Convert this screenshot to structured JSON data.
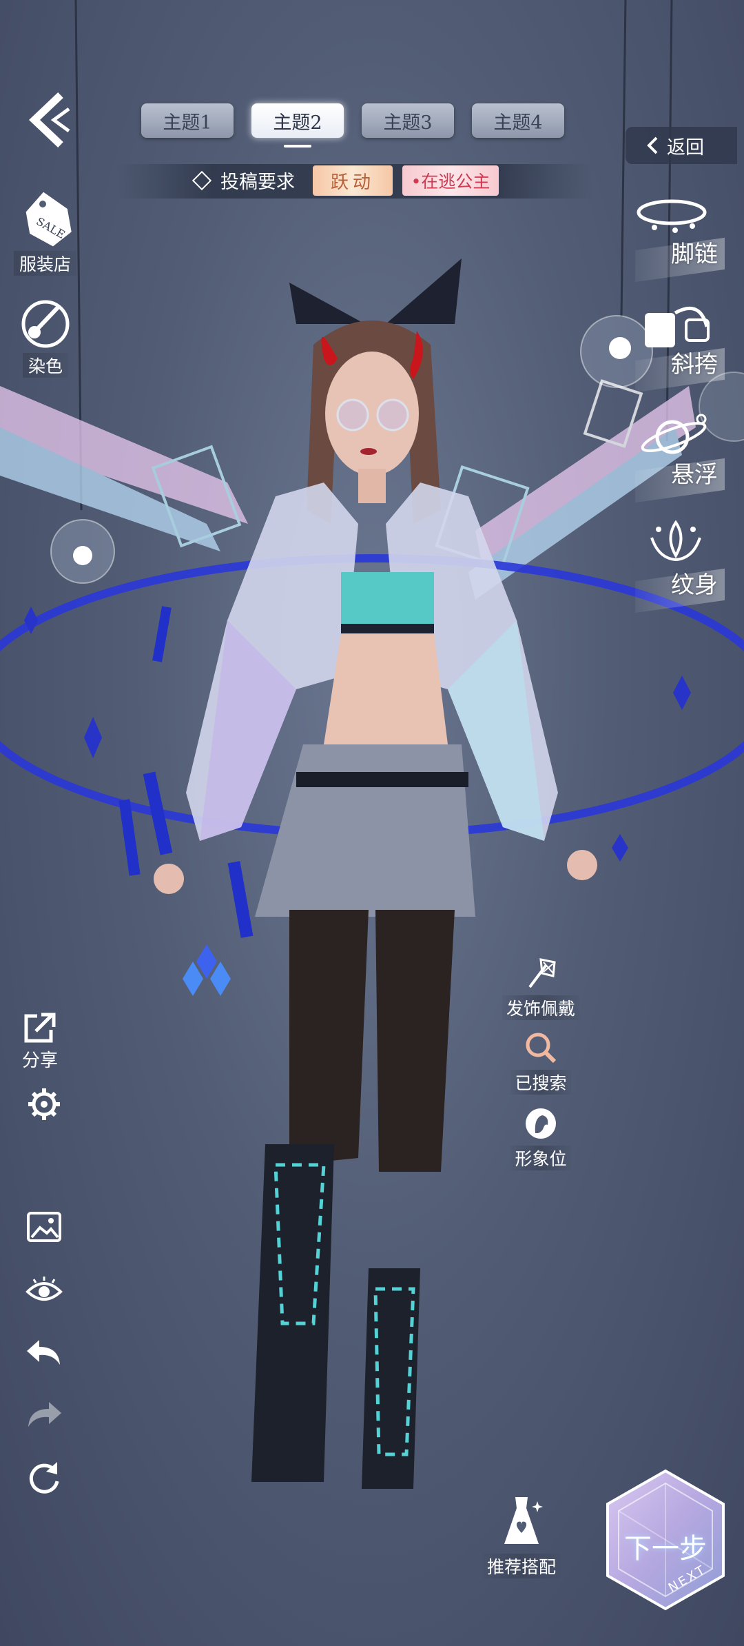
{
  "header": {
    "tabs": [
      {
        "label": "主题1",
        "active": false
      },
      {
        "label": "主题2",
        "active": true
      },
      {
        "label": "主题3",
        "active": false
      },
      {
        "label": "主题4",
        "active": false
      }
    ],
    "back_label": "返回"
  },
  "requirement": {
    "label": "投稿要求",
    "tags": [
      "跃动",
      "•在逃公主"
    ]
  },
  "left_menu": {
    "shop": "服装店",
    "dye": "染色",
    "share": "分享"
  },
  "right_categories": [
    "脚链",
    "斜挎",
    "悬浮",
    "纹身"
  ],
  "mid_actions": {
    "hair_accessory": "发饰佩戴",
    "searched": "已搜索",
    "image_slot": "形象位"
  },
  "recommend_label": "推荐搭配",
  "next": {
    "label": "下一步",
    "sub": "NEXT"
  },
  "colors": {
    "tag_yue_text": "#b9603a",
    "tag_princess_text": "#d03a52",
    "ring_blue": "#2a37d8",
    "accent_cyan": "#3fd6d8"
  }
}
